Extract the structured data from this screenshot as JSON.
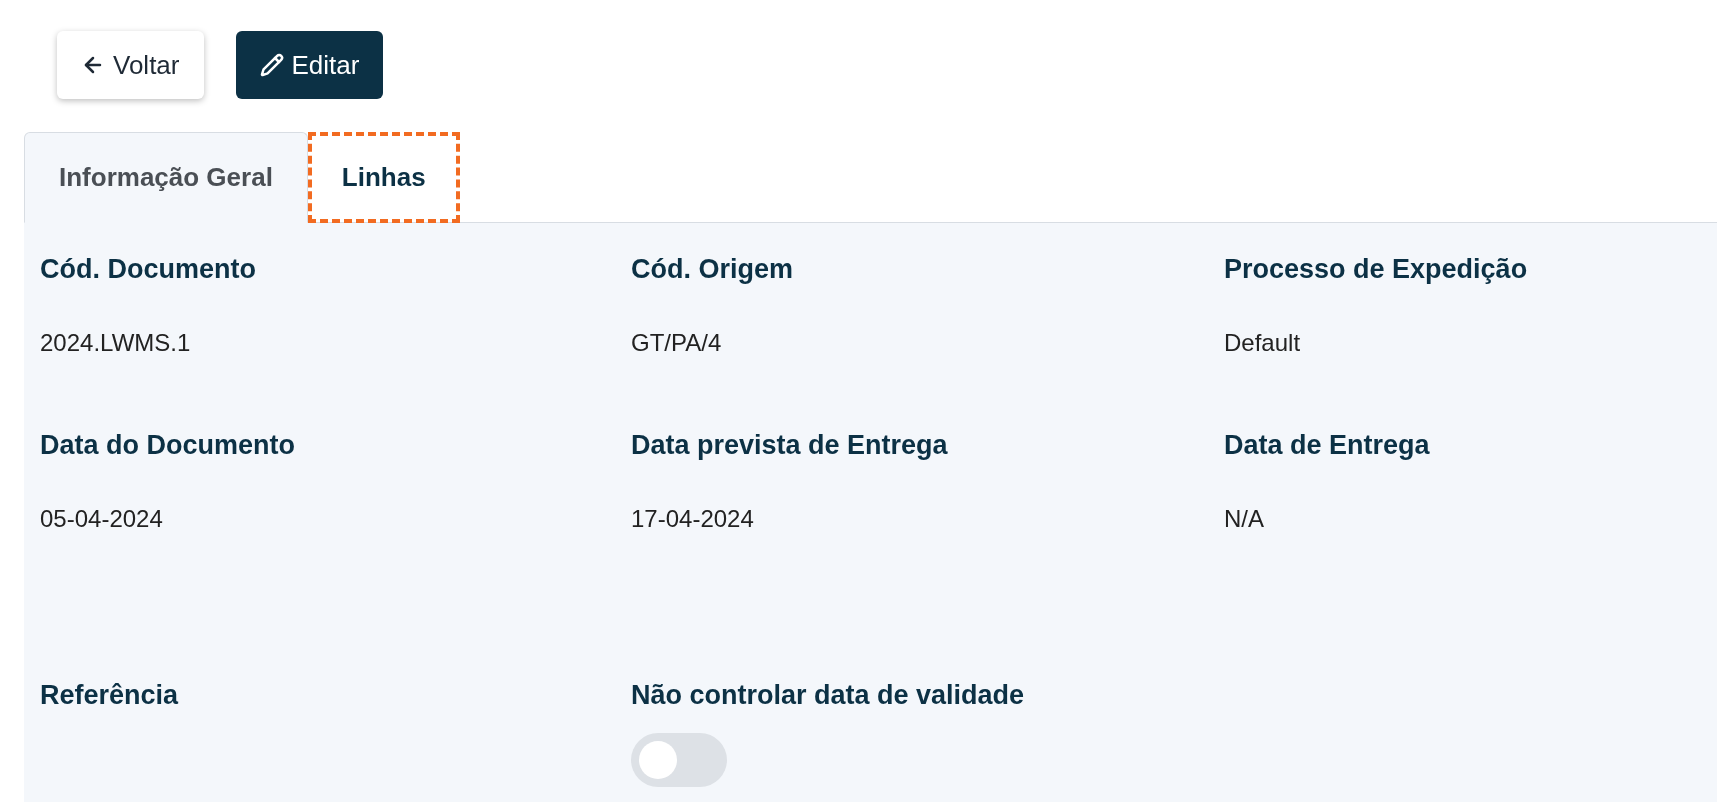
{
  "buttons": [
    {
      "kind": "back",
      "label": "Voltar"
    },
    {
      "kind": "edit",
      "label": "Editar"
    }
  ],
  "tabs": [
    {
      "label": "Informação Geral",
      "selected": true,
      "highlighted": false
    },
    {
      "label": "Linhas",
      "selected": false,
      "highlighted": true
    }
  ],
  "fields": [
    {
      "kind": "text",
      "label": "Cód. Documento",
      "value": "2024.LWMS.1"
    },
    {
      "kind": "text",
      "label": "Cód. Origem",
      "value": "GT/PA/4"
    },
    {
      "kind": "text",
      "label": "Processo de Expedição",
      "value": "Default"
    },
    {
      "kind": "text",
      "label": "Data do Documento",
      "value": "05-04-2024"
    },
    {
      "kind": "text",
      "label": "Data prevista de Entrega",
      "value": "17-04-2024"
    },
    {
      "kind": "text",
      "label": "Data de Entrega",
      "value": "N/A"
    },
    {
      "kind": "text",
      "label": "Referência"
    },
    {
      "kind": "toggle",
      "label": "Não controlar data de validade",
      "on": false
    }
  ]
}
